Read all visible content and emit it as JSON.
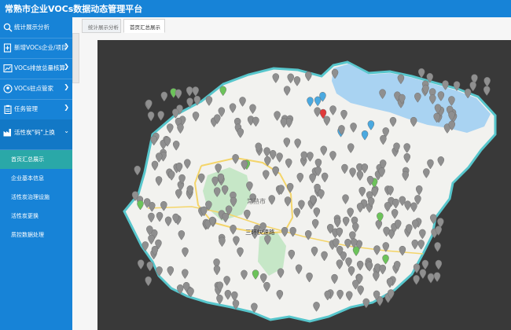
{
  "app": {
    "title": "常熟市企业VOCs数据动态管理平台"
  },
  "sidebar": {
    "items": [
      {
        "label": "统计展示分析",
        "icon": "search-icon",
        "has_chevron": false
      },
      {
        "label": "新增VOCs企业/项目",
        "icon": "add-doc-icon",
        "has_chevron": true
      },
      {
        "label": "VOCs排放总量核算",
        "icon": "chart-icon",
        "has_chevron": true
      },
      {
        "label": "VOCs驻点管家",
        "icon": "person-icon",
        "has_chevron": true
      },
      {
        "label": "任务管理",
        "icon": "clipboard-icon",
        "has_chevron": true
      },
      {
        "label": "活性炭\"码\"上换",
        "icon": "factory-icon",
        "has_chevron": true,
        "expanded": true
      }
    ],
    "subitems": [
      {
        "label": "首页汇总展示",
        "active": true
      },
      {
        "label": "企业基本信息",
        "active": false
      },
      {
        "label": "活性炭治理设施",
        "active": false
      },
      {
        "label": "活性炭更换",
        "active": false
      },
      {
        "label": "质控数据处理",
        "active": false
      }
    ]
  },
  "tabs": [
    {
      "label": "统计展示分析",
      "active": false
    },
    {
      "label": "首页汇总展示",
      "active": true
    }
  ],
  "map": {
    "labels": {
      "city": "常熟市",
      "road": "三环快速路"
    },
    "colors": {
      "background": "#393939",
      "land": "#f2f2ef",
      "boundary": "#57c6cc",
      "water": "#a9d3f2",
      "park": "#c6e7c7",
      "marker_gray": "#8f8f8f",
      "marker_blue": "#4aa9e0",
      "marker_green": "#6cc35a",
      "marker_red": "#e03a3a"
    }
  }
}
